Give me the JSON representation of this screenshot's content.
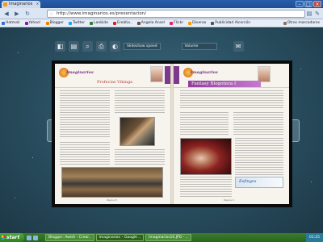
{
  "window": {
    "tab_title": "Imaginarios",
    "tab_close": "x",
    "buttons": {
      "minimize": "–",
      "maximize": "□",
      "close": "×"
    }
  },
  "navbar": {
    "back": "◀",
    "forward": "▶",
    "reload": "↻",
    "url": "http://www.imaginarios.es/presentacion/",
    "page_menu": "▤",
    "tools_menu": "✎"
  },
  "bookmarks": [
    {
      "label": "Hotmail",
      "color": "#2c6fd1"
    },
    {
      "label": "Yahoo!",
      "color": "#7b1fa2"
    },
    {
      "label": "Blogger",
      "color": "#f57c00"
    },
    {
      "label": "Twitter",
      "color": "#1da1f2"
    },
    {
      "label": "Lanbide",
      "color": "#2e7d32"
    },
    {
      "label": "Ereátia..",
      "color": "#c62828"
    },
    {
      "label": "Angela Ansel",
      "color": "#6d4c41"
    },
    {
      "label": "Flickr",
      "color": "#e91e63"
    },
    {
      "label": "Diverxo",
      "color": "#ff9800"
    },
    {
      "label": "Publicidad Alcorcón",
      "color": "#455a64"
    },
    {
      "label": "Otros marcadores",
      "color": "#8d6e63"
    }
  ],
  "viewer": {
    "slideshow": "Slideshow speed",
    "volume": "Volume",
    "prev_arrow": "‹",
    "next_arrow": "›",
    "tools": [
      "◧",
      "▤",
      "⌕",
      "⎙",
      "◐",
      "✉"
    ]
  },
  "magazine": {
    "brand": "Imaginarios",
    "left_page": {
      "title": "Profecías Vikinga",
      "folio": "Página 8"
    },
    "right_page": {
      "title": "Fantasy Blogoteca I",
      "banner": "Esfinges",
      "folio": "Página 9"
    }
  },
  "taskbar": {
    "start": "start",
    "windows": [
      {
        "label": "Blogger: Awish - Crear..",
        "active": false
      },
      {
        "label": "Imaginarios – Google ..",
        "active": true
      },
      {
        "label": "Imaginarios10.JPG - ..",
        "active": false
      }
    ],
    "clock": "01:25"
  }
}
